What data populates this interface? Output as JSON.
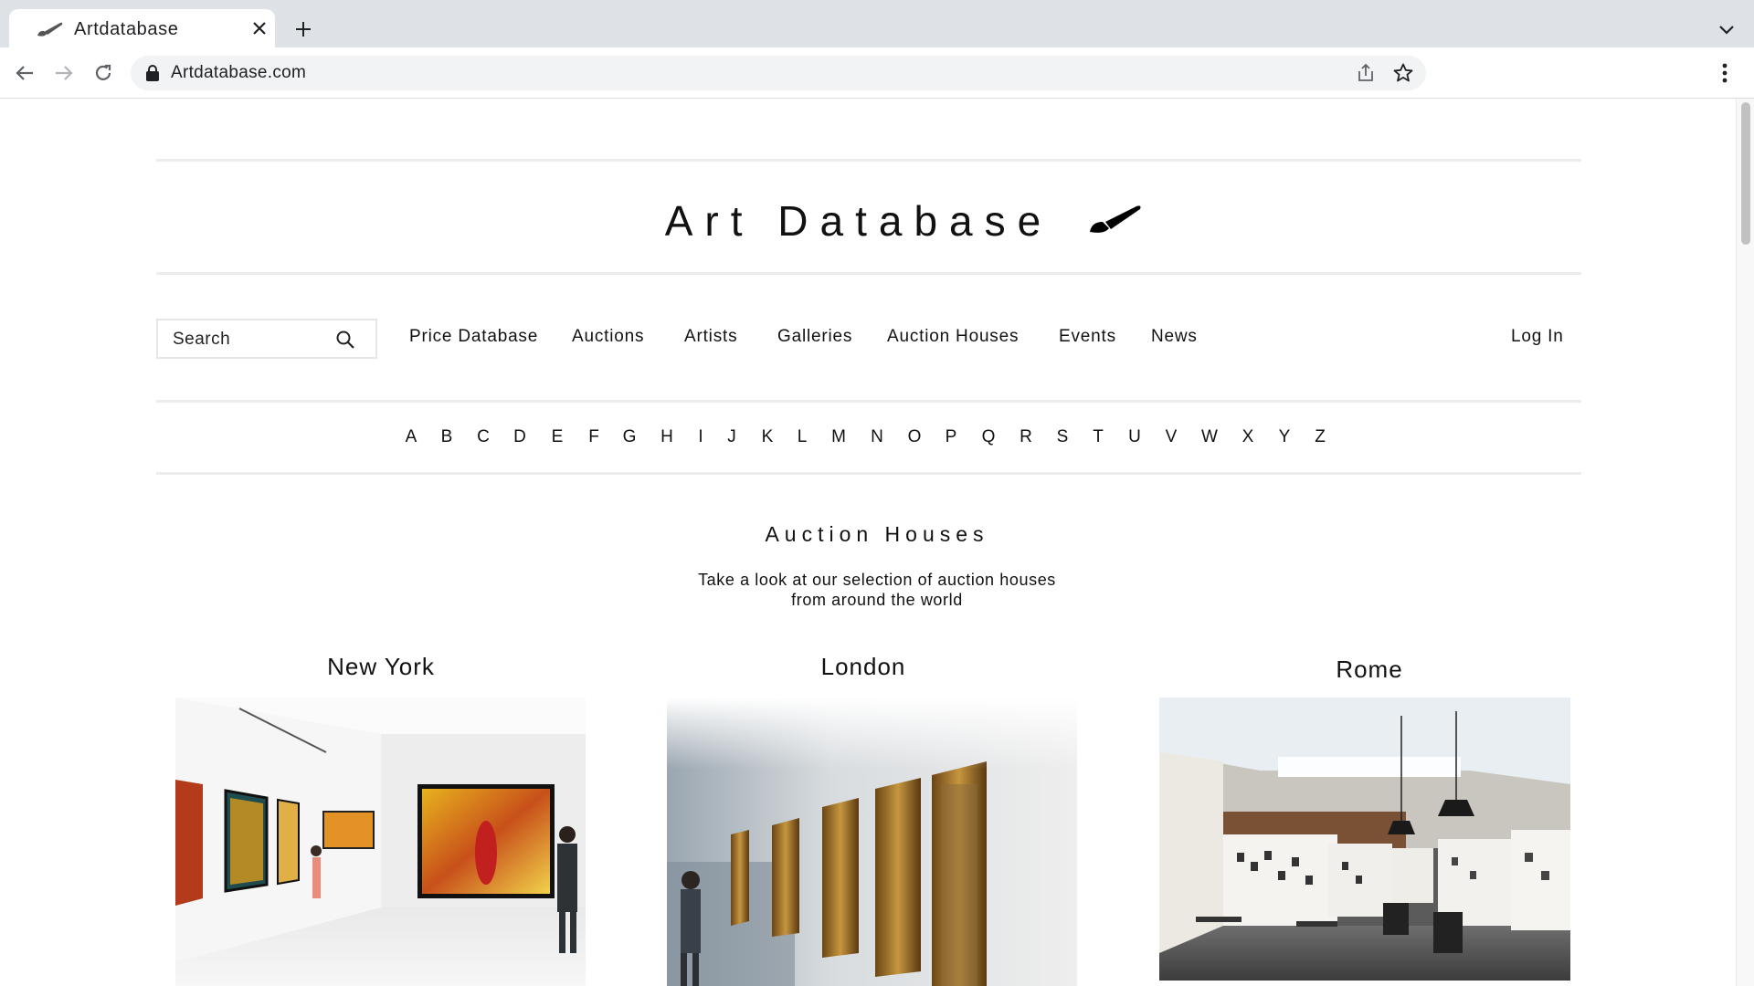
{
  "browser": {
    "tab_title": "Artdatabase",
    "url": "Artdatabase.com"
  },
  "site": {
    "title": "Art Database",
    "search": {
      "placeholder": "Search"
    },
    "nav": [
      "Price Database",
      "Auctions",
      "Artists",
      "Galleries",
      "Auction Houses",
      "Events",
      "News"
    ],
    "login": "Log In",
    "alphabet": [
      "A",
      "B",
      "C",
      "D",
      "E",
      "F",
      "G",
      "H",
      "I",
      "J",
      "K",
      "L",
      "M",
      "N",
      "O",
      "P",
      "Q",
      "R",
      "S",
      "T",
      "U",
      "V",
      "W",
      "X",
      "Y",
      "Z"
    ]
  },
  "section": {
    "title": "Auction Houses",
    "subtitle_line1": "Take a look at our selection of auction houses",
    "subtitle_line2": "from around the world"
  },
  "cards": [
    {
      "city": "New York"
    },
    {
      "city": "London"
    },
    {
      "city": "Rome"
    }
  ],
  "colors": {
    "chrome_bg": "#dee1e6",
    "omnibox_bg": "#f1f3f4",
    "divider": "#ececec",
    "text": "#111111"
  }
}
